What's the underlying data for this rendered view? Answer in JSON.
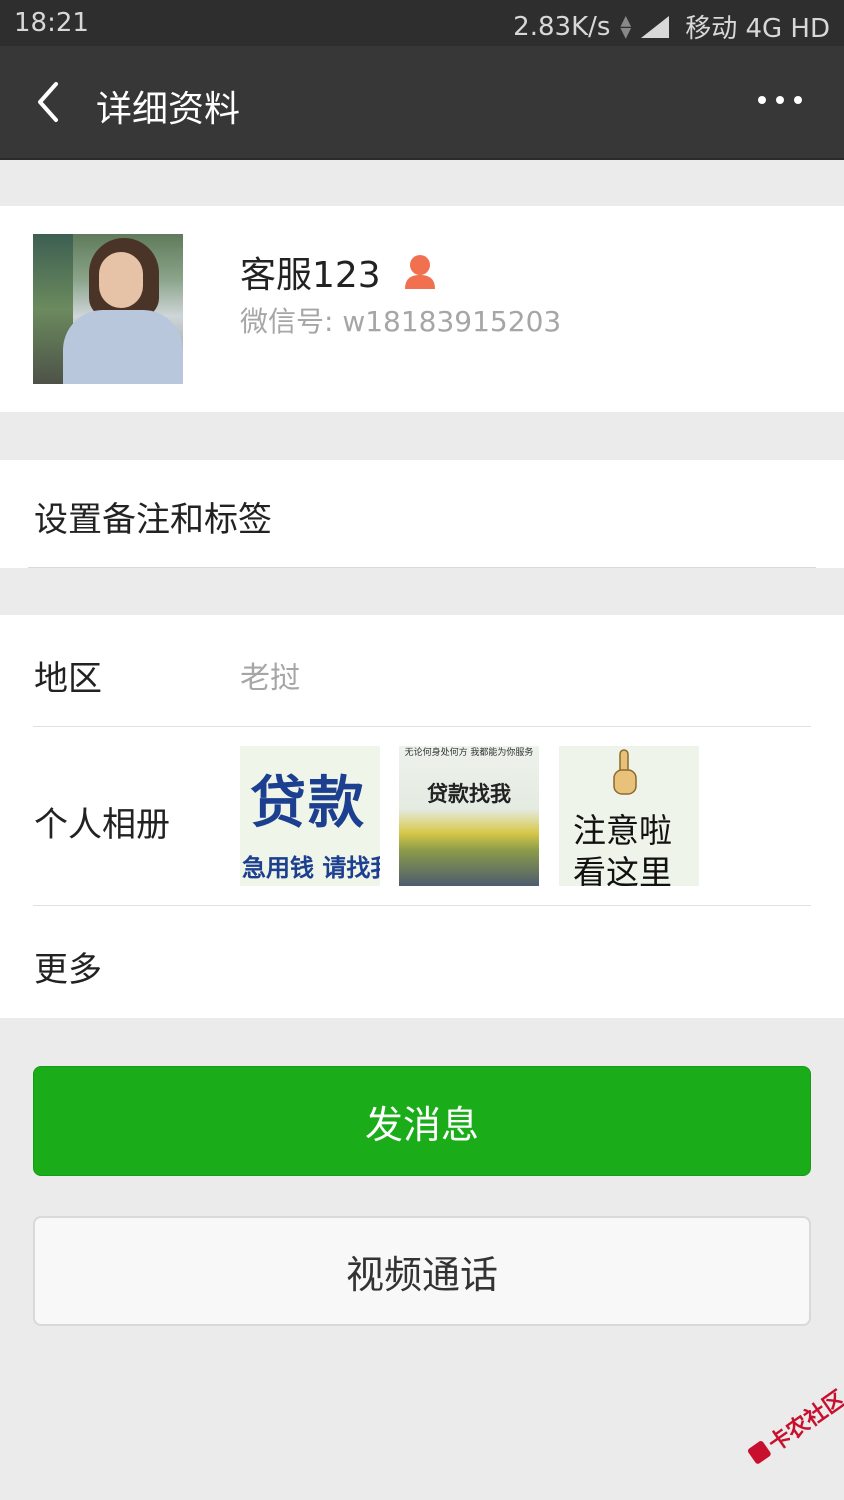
{
  "status_bar": {
    "time": "18:21",
    "speed": "2.83K/s",
    "carrier": "移动 4G HD"
  },
  "header": {
    "title": "详细资料",
    "back_icon": "chevron-left-icon",
    "more_icon": "more-dots-icon"
  },
  "profile": {
    "name": "客服123",
    "wechat_id": "微信号: w18183915203",
    "gender_icon": "person-icon",
    "gender_color": "#f0704f"
  },
  "remark": {
    "label": "设置备注和标签"
  },
  "info": {
    "region_label": "地区",
    "region_value": "老挝",
    "album_label": "个人相册",
    "more_label": "更多",
    "albums": [
      {
        "big": "贷款",
        "small": "急用钱 请找我！"
      },
      {
        "tiny": "无论何身处何方 我都能为你服务",
        "mid": "贷款找我"
      },
      {
        "line1": "注意啦",
        "line2": "看这里"
      }
    ]
  },
  "actions": {
    "send_message": "发消息",
    "video_call": "视频通话"
  },
  "watermark": "卡农社区",
  "colors": {
    "accent": "#1aad19",
    "title_bar": "#373737",
    "status_bar": "#2e2e2e",
    "background": "#ebebeb"
  }
}
